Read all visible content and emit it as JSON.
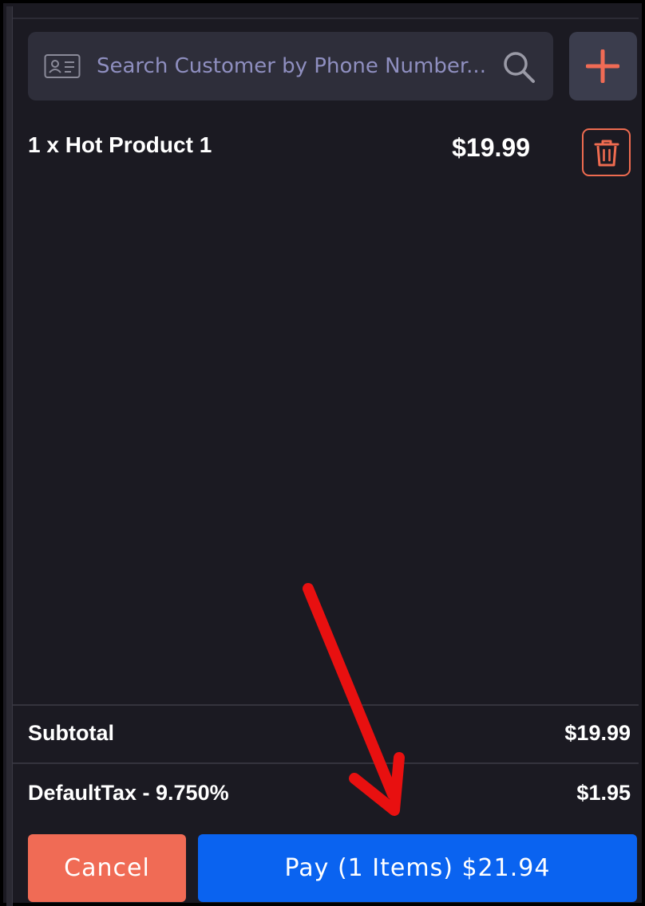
{
  "search": {
    "placeholder": "Search Customer by Phone Number..."
  },
  "cart": {
    "items": [
      {
        "label": "1 x Hot Product 1",
        "price": "$19.99"
      }
    ]
  },
  "totals": {
    "subtotal_label": "Subtotal",
    "subtotal_value": "$19.99",
    "tax_label": "DefaultTax - 9.750%",
    "tax_value": "$1.95"
  },
  "actions": {
    "cancel_label": "Cancel",
    "pay_label": "Pay (1 Items) $21.94"
  },
  "colors": {
    "background": "#1b1a22",
    "search_bg": "#2e2e3a",
    "accent_orange": "#f06b55",
    "pay_blue": "#0a63f0",
    "annotation_red": "#e81010"
  },
  "icons": {
    "id_card": "id-card-icon",
    "search": "search-icon",
    "add": "plus-icon",
    "delete": "trash-icon",
    "annotation": "arrow-icon"
  }
}
